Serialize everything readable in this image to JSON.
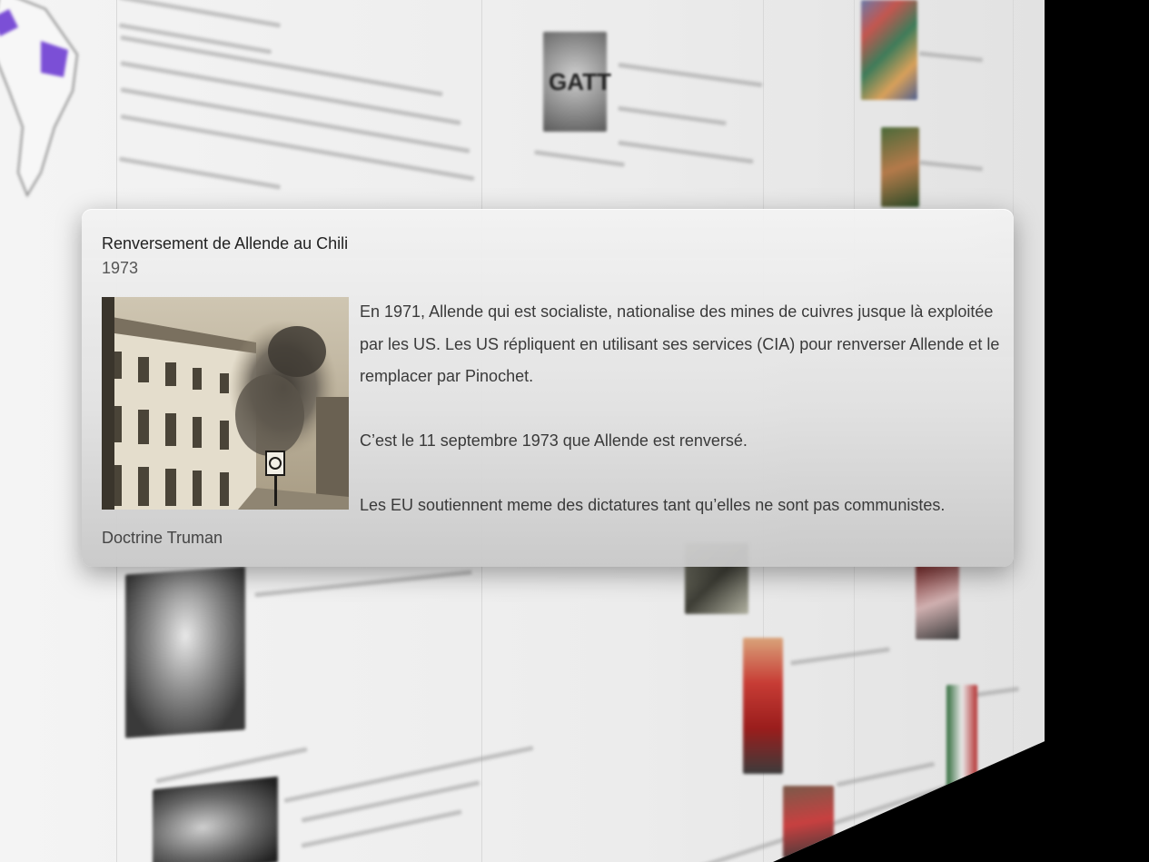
{
  "card": {
    "title": "Renversement de Allende au Chili",
    "year": "1973",
    "paragraphs": [
      "En 1971, Allende qui est socialiste, nationalise des mines de cuivres jusque là exploitée par les US. Les US répliquent en utilisant ses services (CIA) pour renverser Allende et le remplacer par Pinochet.",
      "C’est le 11 septembre 1973 que Allende est renversé.",
      "Les EU soutiennent meme des dictatures tant qu’elles ne sont pas communistes."
    ],
    "footer": "Doctrine Truman",
    "photo_icon": "palace-bombing-photo"
  },
  "background": {
    "gatt_logo_text": "GATT",
    "thumbnail_icons": [
      "map-south-america-icon",
      "gatt-logo",
      "crowd-photo",
      "jungle-photo",
      "portrait-photo",
      "pinochet-photo",
      "chavez-photo",
      "protest-photo"
    ]
  },
  "colors": {
    "map_highlight": "#7b4fd6",
    "card_text": "#3a3a3a",
    "card_title": "#222222"
  }
}
